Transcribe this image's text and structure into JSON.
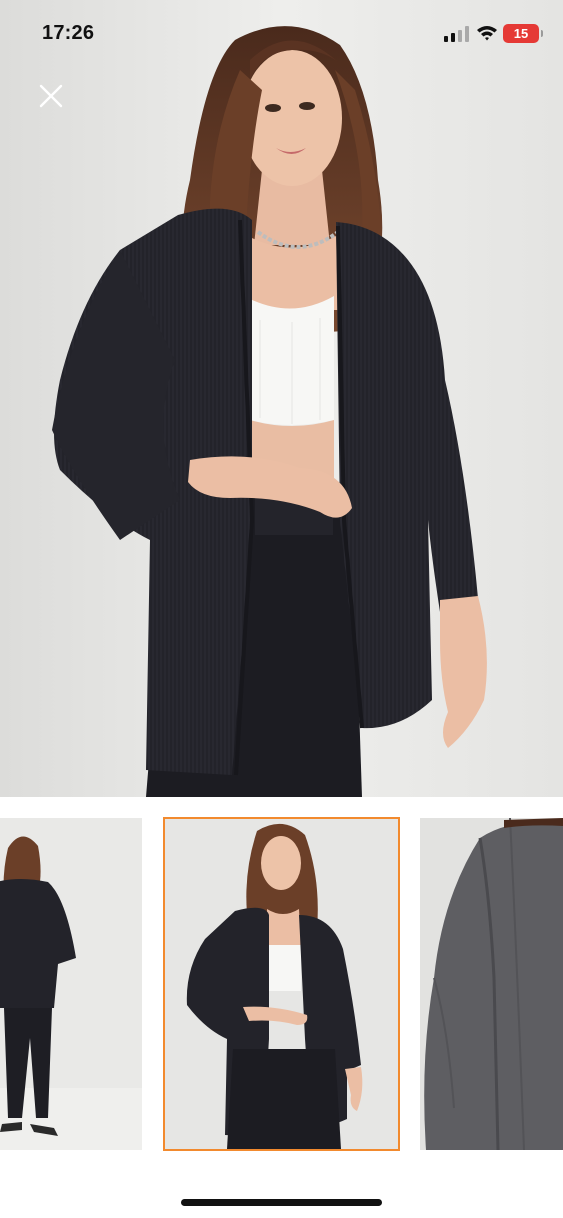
{
  "status_bar": {
    "time": "17:26",
    "battery_level": "15",
    "battery_color": "#e53935",
    "signal_icon": "cellular-signal-icon",
    "wifi_icon": "wifi-icon"
  },
  "viewer": {
    "close_icon": "close-icon",
    "main_image": "product-photo-model-black-kimono-cardigan",
    "thumbnails": [
      {
        "name": "thumbnail-full-body",
        "selected": false
      },
      {
        "name": "thumbnail-front-view",
        "selected": true
      },
      {
        "name": "thumbnail-fabric-detail",
        "selected": false
      }
    ],
    "selected_border_color": "#f28a2e",
    "selected_index": 2
  }
}
